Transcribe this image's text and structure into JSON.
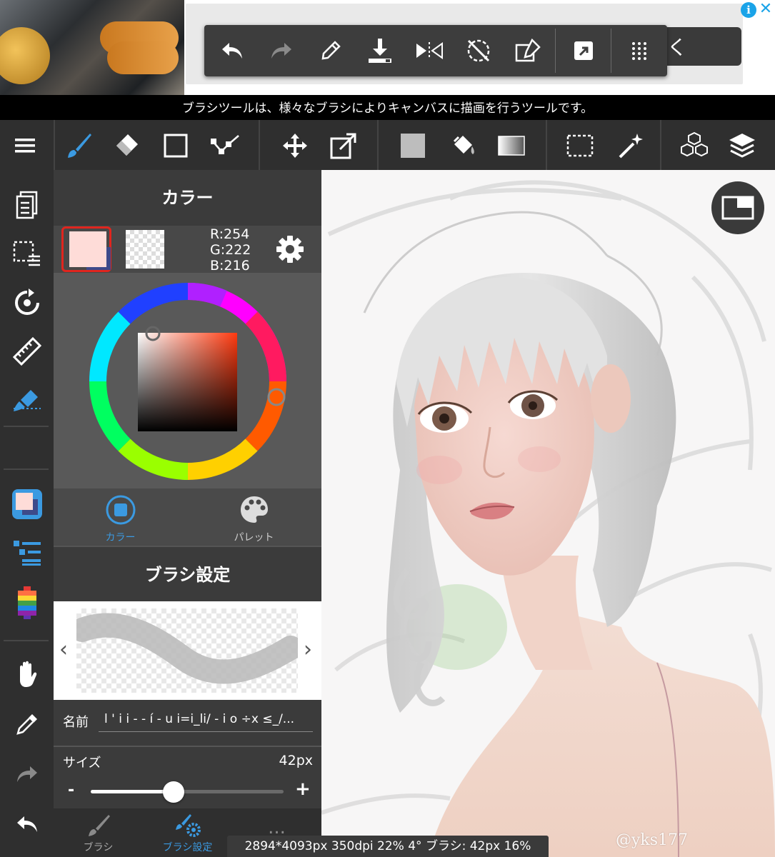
{
  "ad": {
    "button_text": "く",
    "info_icon": "i",
    "close_icon": "✕"
  },
  "floating_toolbar": {
    "icons": [
      "undo-icon",
      "redo-icon",
      "eyedropper-icon",
      "save-icon",
      "flip-icon",
      "rotate-reset-icon",
      "transform-icon",
      "export-icon",
      "grid-menu-icon"
    ]
  },
  "tip_text": "ブラシツールは、様々なブラシによりキャンバスに描画を行うツールです。",
  "toolbar": {
    "icons": [
      "menu-icon",
      "brush-icon",
      "eraser-icon",
      "rect-shape-icon",
      "dot-line-icon",
      "move-icon",
      "transform-icon",
      "fill-color-icon",
      "bucket-icon",
      "gradient-icon",
      "selection-icon",
      "magic-wand-icon",
      "3d-model-icon",
      "layers-icon"
    ]
  },
  "sidebar": {
    "icons": [
      "pages-icon",
      "selection-grid-icon",
      "rotate-icon",
      "ruler-icon",
      "snap-icon",
      "color-panel-icon",
      "brush-list-icon",
      "color-bar-icon",
      "hand-icon",
      "eyedropper-icon",
      "redo-icon",
      "undo-icon"
    ]
  },
  "color_panel": {
    "title": "カラー",
    "main_color": "#fedcd8",
    "r": "R:254",
    "g": "G:222",
    "b": "B:216",
    "tabs": [
      {
        "label": "カラー",
        "active": true
      },
      {
        "label": "パレット",
        "active": false
      }
    ]
  },
  "brush_settings": {
    "title": "ブラシ設定",
    "name_label": "名前",
    "name_value": "l ' i i - - í - u i=i_li/ - i o ÷x ≤_/...",
    "size_label": "サイズ",
    "size_value": "42px",
    "size_fraction": 0.43,
    "minus": "-",
    "plus": "+"
  },
  "bottom_tabs": [
    {
      "label": "ブラシ",
      "active": false
    },
    {
      "label": "ブラシ設定",
      "active": true
    },
    {
      "label": "...",
      "active": false
    }
  ],
  "status_bar": "2894*4093px 350dpi 22% 4° ブラシ: 42px 16%",
  "watermark": "@yks177",
  "colors": {
    "accent": "#3b9ae1",
    "selection_border": "#e0251e"
  }
}
